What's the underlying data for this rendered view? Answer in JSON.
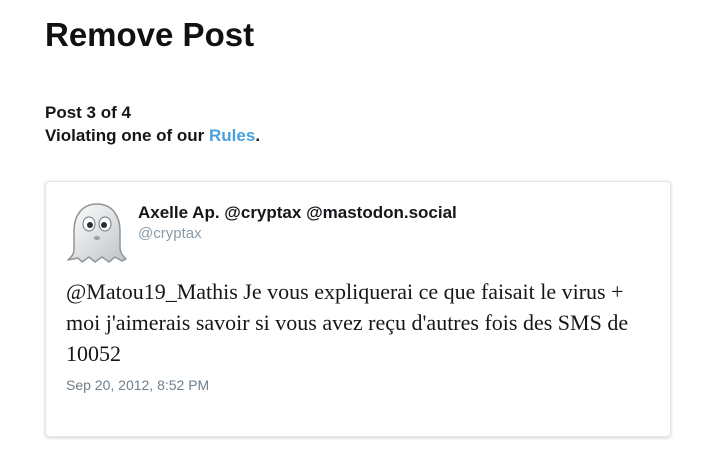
{
  "page": {
    "title": "Remove Post",
    "progress": "Post 3 of 4",
    "reason_prefix": "Violating one of our ",
    "reason_link": "Rules",
    "reason_suffix": "."
  },
  "post": {
    "author_name": "Axelle Ap. @cryptax @mastodon.social",
    "author_handle": "@cryptax",
    "avatar_icon": "ghost-icon",
    "text": "@Matou19_Mathis Je vous expliquerai ce que faisait le virus + moi j'aimerais savoir si vous avez reçu d'autres fois des SMS de 10052",
    "timestamp": "Sep 20, 2012, 8:52 PM"
  },
  "colors": {
    "link": "#4aa0dd",
    "handle": "#8a9aa6",
    "timestamp": "#6f7f8b"
  }
}
